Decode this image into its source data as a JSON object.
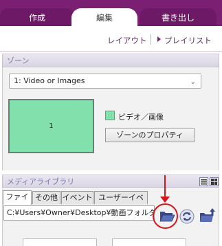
{
  "top_tabs": [
    {
      "label": "作成",
      "active": false
    },
    {
      "label": "編集",
      "active": true
    },
    {
      "label": "書き出し",
      "active": false
    }
  ],
  "sub_nav": {
    "layout_label": "レイアウト",
    "playlist_label": "プレイリスト"
  },
  "zone_panel": {
    "header": "ゾーン",
    "selected_zone": "1: Video or Images",
    "zone_number": "1",
    "legend_label": "ビデオ／画像",
    "properties_button": "ゾーンのプロパティ"
  },
  "media_library": {
    "header": "メディアライブラリ",
    "tabs": [
      "ファイル",
      "その他",
      "イベント",
      "ユーザーイベント"
    ],
    "active_tab": "ファイル",
    "path": "C:¥Users¥Owner¥Desktop¥動画フォルダ"
  },
  "colors": {
    "brand_purple": "#7b1f72",
    "zone_green": "#82e0ac",
    "annotation_red": "#d4161b"
  },
  "icons": {
    "folder": "open-folder-icon",
    "refresh": "refresh-icon",
    "upload": "folder-upload-icon",
    "list_view": "list-view-icon",
    "grid_view": "grid-view-icon"
  }
}
